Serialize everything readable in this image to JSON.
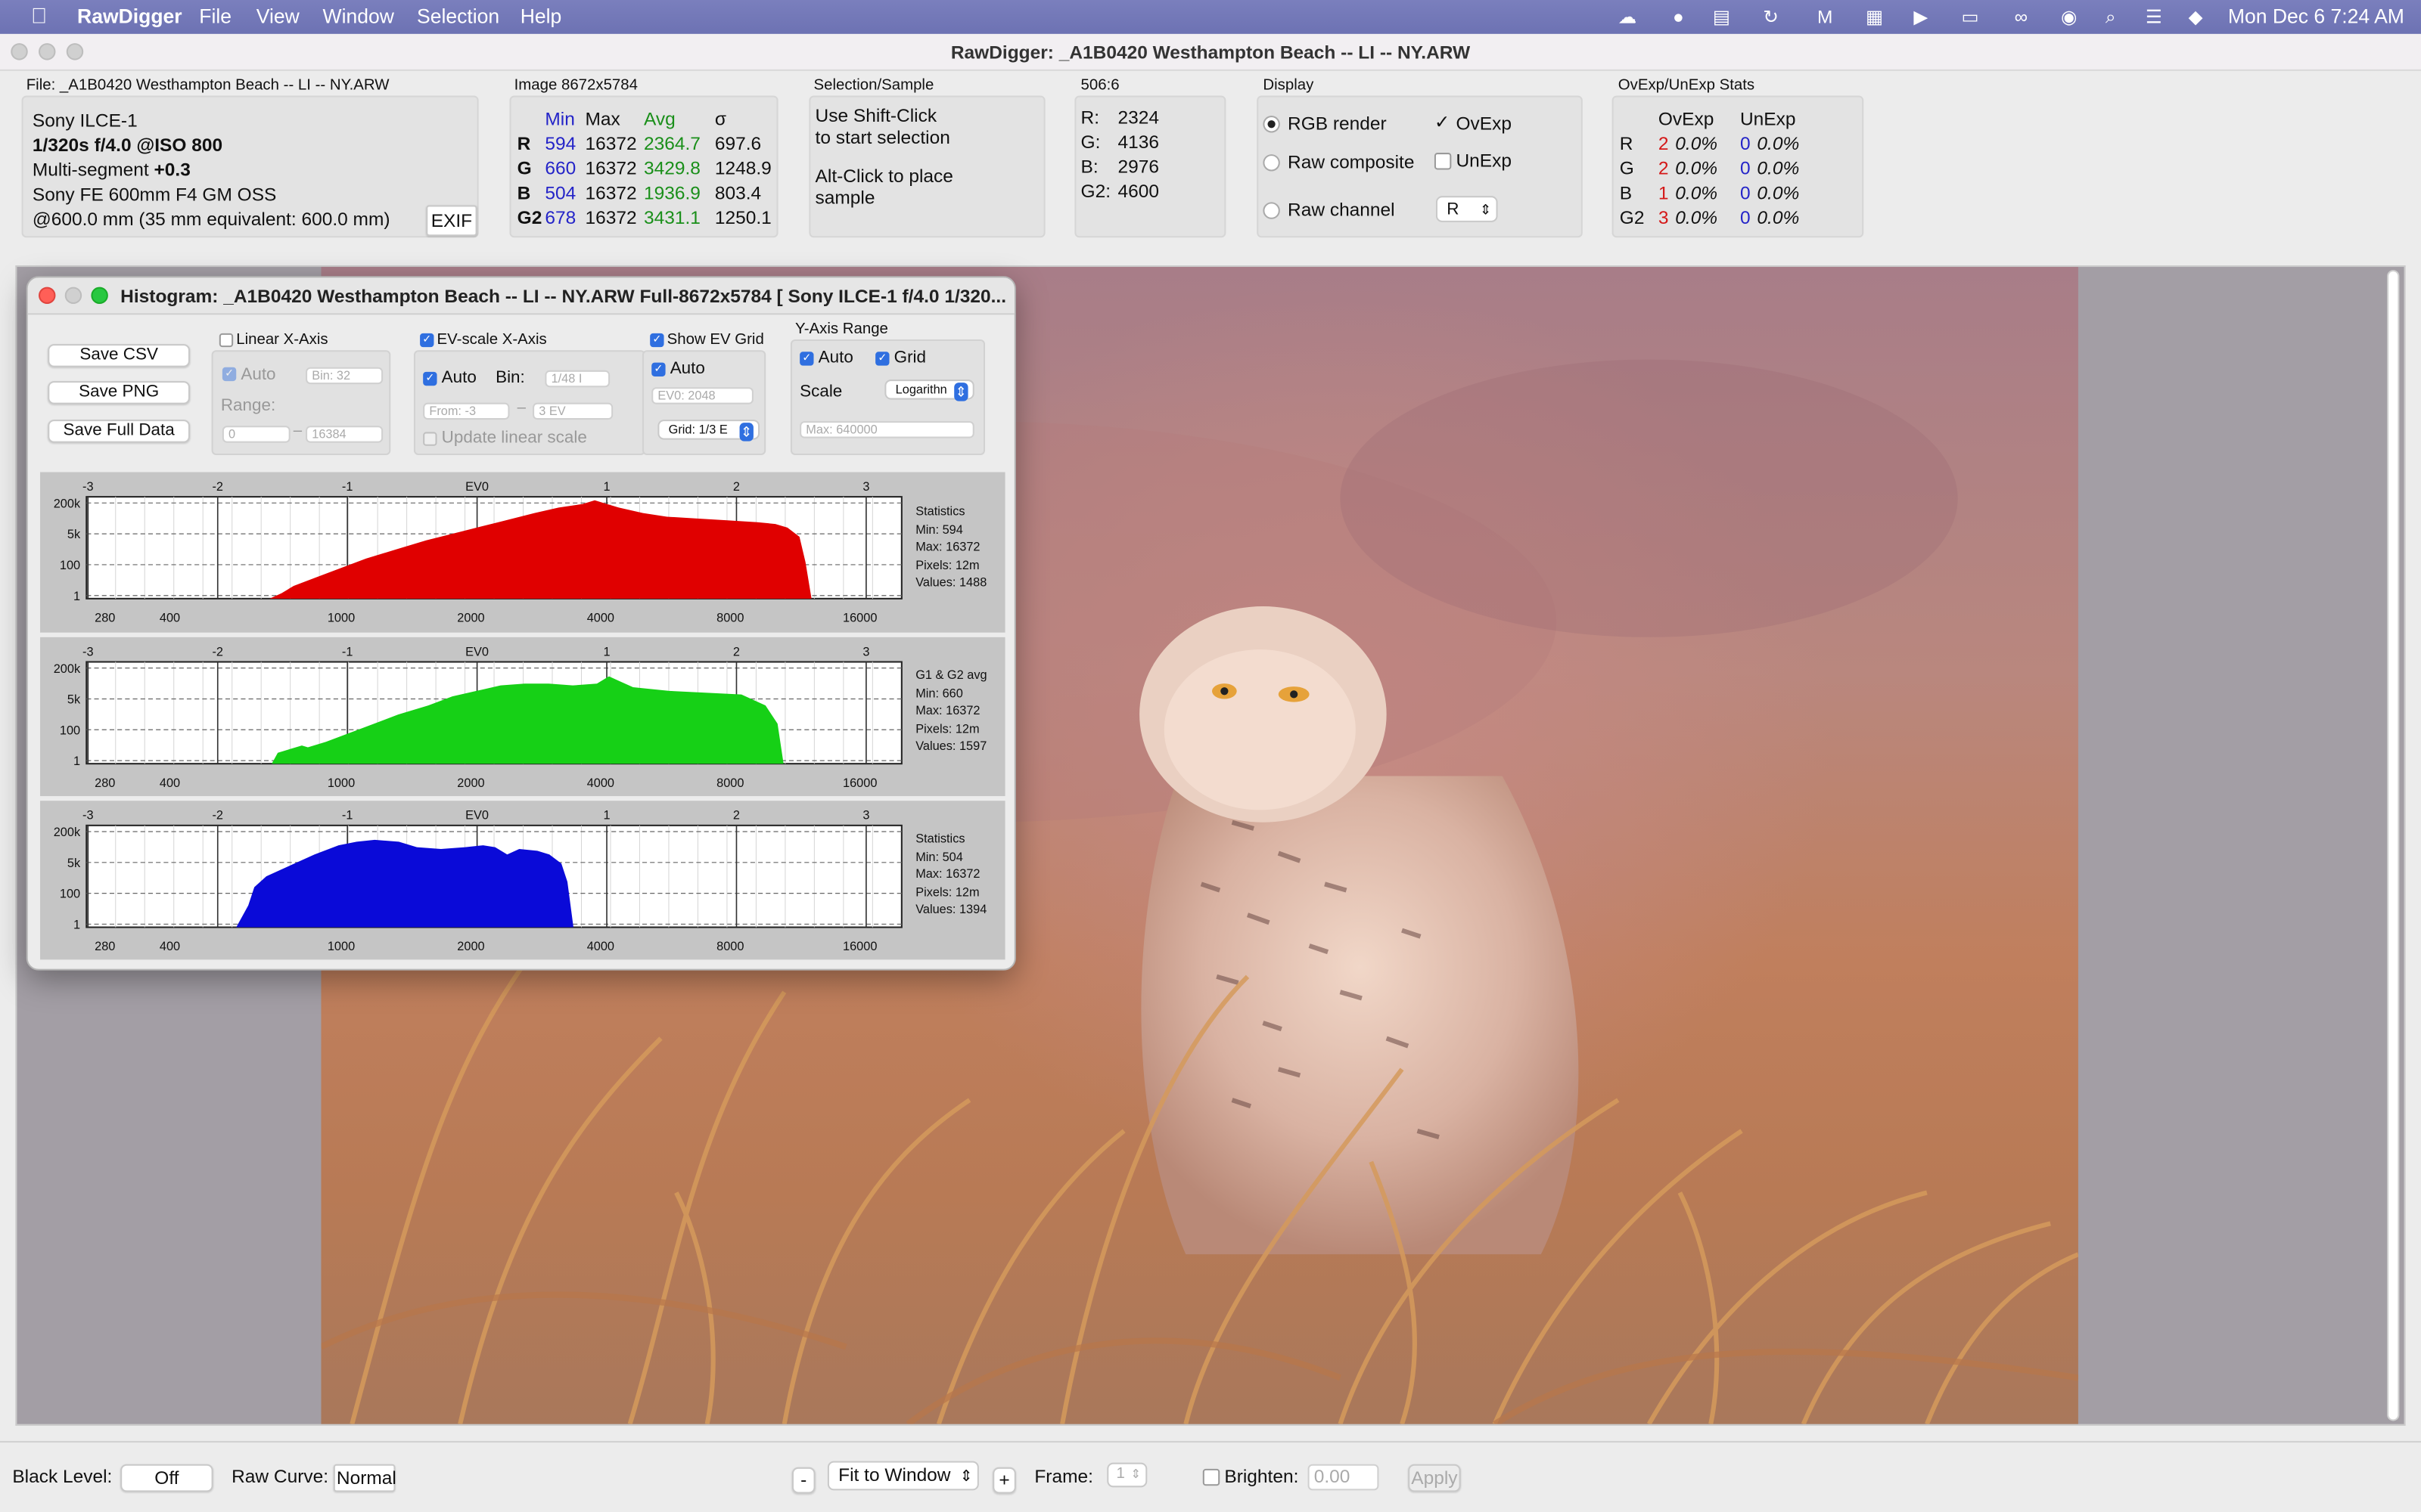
{
  "menubar": {
    "app": "RawDigger",
    "items": [
      "File",
      "View",
      "Window",
      "Selection",
      "Help"
    ],
    "clock": "Mon Dec 6  7:24 AM"
  },
  "window": {
    "title": "RawDigger: _A1B0420  Westhampton Beach -- LI -- NY.ARW"
  },
  "file": {
    "label": "File: _A1B0420  Westhampton Beach -- LI -- NY.ARW",
    "camera": "Sony ILCE-1",
    "exposure": "1/320s f/4.0 @ISO 800",
    "multiseg_prefix": "Multi-segment ",
    "multiseg_val": "+0.3",
    "lens": "Sony FE 600mm F4 GM OSS",
    "focal": "@600.0 mm (35 mm equivalent: 600.0 mm)",
    "exif_button": "EXIF"
  },
  "image": {
    "label": "Image 8672x5784",
    "headers": [
      "Min",
      "Max",
      "Avg",
      "σ"
    ],
    "rows": [
      {
        "ch": "R",
        "min": "594",
        "max": "16372",
        "avg": "2364.7",
        "sd": "697.6"
      },
      {
        "ch": "G",
        "min": "660",
        "max": "16372",
        "avg": "3429.8",
        "sd": "1248.9"
      },
      {
        "ch": "B",
        "min": "504",
        "max": "16372",
        "avg": "1936.9",
        "sd": "803.4"
      },
      {
        "ch": "G2",
        "min": "678",
        "max": "16372",
        "avg": "3431.1",
        "sd": "1250.1"
      }
    ]
  },
  "selection": {
    "label": "Selection/Sample",
    "l1": "Use Shift-Click",
    "l2": "to start selection",
    "l3": "Alt-Click to place",
    "l4": "sample"
  },
  "sample": {
    "label": "506:6",
    "rows": [
      {
        "k": "R:",
        "v": "2324"
      },
      {
        "k": "G:",
        "v": "4136"
      },
      {
        "k": "B:",
        "v": "2976"
      },
      {
        "k": "G2:",
        "v": "4600"
      }
    ]
  },
  "display": {
    "label": "Display",
    "rgb": "RGB render",
    "rawcomp": "Raw composite",
    "rawch": "Raw channel",
    "ovexp": "OvExp",
    "unexp": "UnExp",
    "channel": "R"
  },
  "ovstats": {
    "label": "OvExp/UnExp Stats",
    "h1": "OvExp",
    "h2": "UnExp",
    "rows": [
      {
        "ch": "R",
        "on": "2",
        "op": "0.0%",
        "un": "0",
        "up": "0.0%"
      },
      {
        "ch": "G",
        "on": "2",
        "op": "0.0%",
        "un": "0",
        "up": "0.0%"
      },
      {
        "ch": "B",
        "on": "1",
        "op": "0.0%",
        "un": "0",
        "up": "0.0%"
      },
      {
        "ch": "G2",
        "on": "3",
        "op": "0.0%",
        "un": "0",
        "up": "0.0%"
      }
    ]
  },
  "hist": {
    "title": "Histogram: _A1B0420  Westhampton Beach -- LI -- NY.ARW Full-8672x5784 [ Sony ILCE-1 f/4.0 1/320...",
    "save_csv": "Save CSV",
    "save_png": "Save PNG",
    "save_full": "Save Full Data",
    "linear": "Linear X-Axis",
    "auto": "Auto",
    "bin32": "Bin: 32",
    "range": "Range:",
    "r0": "0",
    "r1": "16384",
    "evscale": "EV-scale X-Axis",
    "bin": "Bin:",
    "bin48": "1/48 I",
    "from": "From: -3",
    "to": "3 EV",
    "update": "Update linear scale",
    "showev": "Show EV Grid",
    "ev0": "EV0: 2048",
    "gridsel": "Grid: 1/3 E",
    "yrange": "Y-Axis Range",
    "grid": "Grid",
    "scale": "Scale",
    "log": "Logarithn",
    "max": "Max: 640000",
    "ev_ticks": [
      "-3",
      "-2",
      "-1",
      "EV0",
      "1",
      "2",
      "3"
    ],
    "y_ticks": [
      "200k",
      "5k",
      "100",
      "1"
    ],
    "x_ticks": [
      "280",
      "400",
      "1000",
      "2000",
      "4000",
      "8000",
      "16000"
    ],
    "panels": [
      {
        "color": "#e00000",
        "stats": [
          "Statistics",
          "Min: 594",
          "Max: 16372",
          "Pixels: 12m",
          "Values: 1488"
        ]
      },
      {
        "color": "#16d016",
        "stats": [
          "G1 & G2 avg",
          "Min: 660",
          "Max: 16372",
          "Pixels: 12m",
          "Values: 1597"
        ]
      },
      {
        "color": "#0a0ad8",
        "stats": [
          "Statistics",
          "Min: 504",
          "Max: 16372",
          "Pixels: 12m",
          "Values: 1394"
        ]
      }
    ]
  },
  "bottom": {
    "black": "Black Level:",
    "off": "Off",
    "rawcurve": "Raw Curve:",
    "normal": "Normal",
    "minus": "-",
    "fit": "Fit to Window",
    "plus": "+",
    "frame": "Frame:",
    "frame_val": "1",
    "brighten": "Brighten:",
    "bright_val": "0.00",
    "apply": "Apply"
  }
}
